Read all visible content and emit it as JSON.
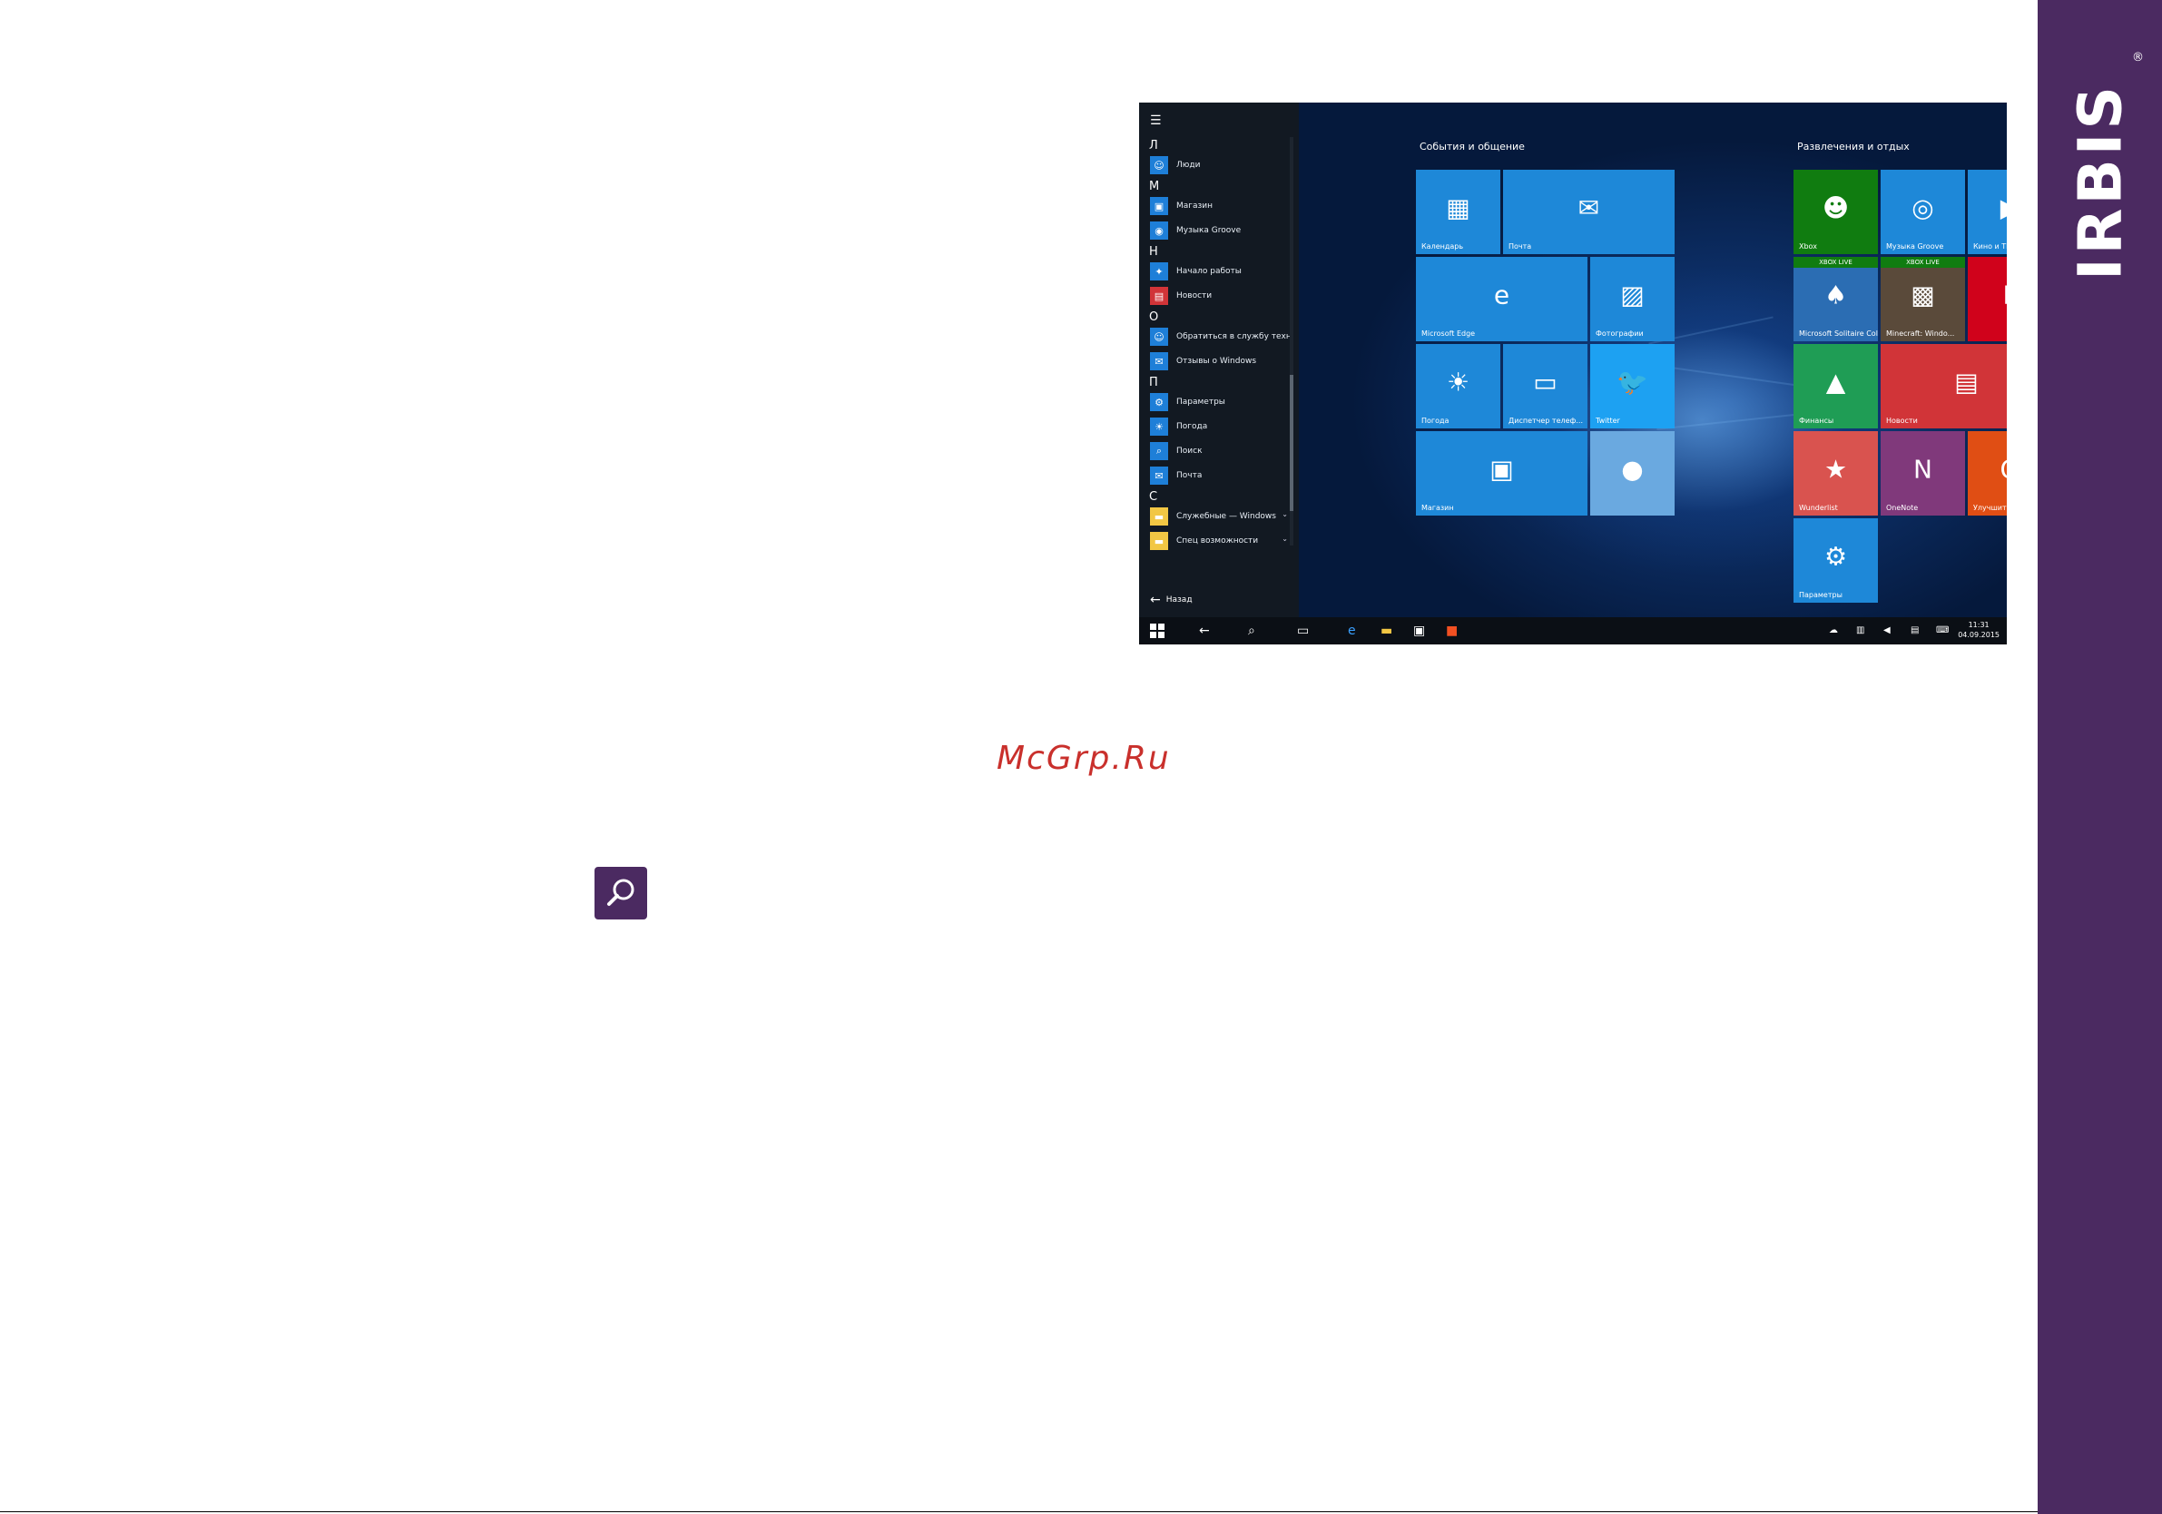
{
  "brand": {
    "name": "IRBIS",
    "reg": "®"
  },
  "watermark": "McGrp.Ru",
  "start_list": {
    "items": [
      {
        "type": "letter",
        "text": "Л"
      },
      {
        "type": "app",
        "label": "Люди",
        "color": "#1e7fd8",
        "icon": "people-icon"
      },
      {
        "type": "letter",
        "text": "М"
      },
      {
        "type": "app",
        "label": "Магазин",
        "color": "#1e7fd8",
        "icon": "store-icon"
      },
      {
        "type": "app",
        "label": "Музыка Groove",
        "color": "#1e7fd8",
        "icon": "music-icon"
      },
      {
        "type": "letter",
        "text": "Н"
      },
      {
        "type": "app",
        "label": "Начало работы",
        "color": "#1e7fd8",
        "icon": "bulb-icon"
      },
      {
        "type": "app",
        "label": "Новости",
        "color": "#d13438",
        "icon": "news-icon"
      },
      {
        "type": "letter",
        "text": "О"
      },
      {
        "type": "app",
        "label": "Обратиться в службу технич...",
        "color": "#1e7fd8",
        "icon": "support-icon"
      },
      {
        "type": "app",
        "label": "Отзывы о Windows",
        "color": "#1e7fd8",
        "icon": "feedback-icon"
      },
      {
        "type": "letter",
        "text": "П"
      },
      {
        "type": "app",
        "label": "Параметры",
        "color": "#1e7fd8",
        "icon": "gear-icon"
      },
      {
        "type": "app",
        "label": "Погода",
        "color": "#1e7fd8",
        "icon": "weather-icon"
      },
      {
        "type": "app",
        "label": "Поиск",
        "color": "#1e7fd8",
        "icon": "search-icon"
      },
      {
        "type": "app",
        "label": "Почта",
        "color": "#1e7fd8",
        "icon": "mail-icon"
      },
      {
        "type": "letter",
        "text": "С"
      },
      {
        "type": "app",
        "label": "Служебные — Windows",
        "color": "#f2c744",
        "icon": "folder-icon",
        "expand": true
      },
      {
        "type": "app",
        "label": "Спец возможности",
        "color": "#f2c744",
        "icon": "folder-icon",
        "expand": true
      }
    ],
    "back_label": "Назад"
  },
  "groups": [
    {
      "title": "События и общение"
    },
    {
      "title": "Развлечения и отдых"
    }
  ],
  "tiles": [
    {
      "label": "Календарь",
      "color": "#1e88d8",
      "icon": "calendar-icon"
    },
    {
      "label": "Почта",
      "color": "#1e88d8",
      "icon": "mail-icon"
    },
    {
      "label": "Microsoft Edge",
      "color": "#1e88d8",
      "icon": "edge-icon"
    },
    {
      "label": "Фотографии",
      "color": "#1e88d8",
      "icon": "photos-icon"
    },
    {
      "label": "Погода",
      "color": "#1e88d8",
      "icon": "weather-icon"
    },
    {
      "label": "Диспетчер телеф...",
      "color": "#1e88d8",
      "icon": "phone-icon"
    },
    {
      "label": "Twitter",
      "color": "#1da1f2",
      "icon": "twitter-icon"
    },
    {
      "label": "Магазин",
      "color": "#1e88d8",
      "icon": "store-icon"
    },
    {
      "label": "",
      "color": "#6aa9e0",
      "icon": "candy-icon"
    },
    {
      "label": "Xbox",
      "color": "#107c10",
      "icon": "xbox-icon"
    },
    {
      "label": "Музыка Groove",
      "color": "#1e88d8",
      "icon": "music-icon"
    },
    {
      "label": "Кино и ТВ",
      "color": "#1e88d8",
      "icon": "film-icon"
    },
    {
      "label": "Microsoft Solitaire Collection",
      "color": "#2b6db3",
      "icon": "cards-icon",
      "badge": "XBOX LIVE"
    },
    {
      "label": "Minecraft: Windo...",
      "color": "#5a4a3a",
      "icon": "minecraft-icon",
      "badge": "XBOX LIVE"
    },
    {
      "label": "",
      "color": "#d0021b",
      "icon": "flipboard-icon"
    },
    {
      "label": "Финансы",
      "color": "#1f9d55",
      "icon": "finance-icon"
    },
    {
      "label": "Новости",
      "color": "#d13438",
      "icon": "news-icon"
    },
    {
      "label": "Wunderlist",
      "color": "#d9534f",
      "icon": "star-icon"
    },
    {
      "label": "OneNote",
      "color": "#80397b",
      "icon": "onenote-icon"
    },
    {
      "label": "Улучшите...",
      "color": "#e04e14",
      "icon": "office-icon"
    },
    {
      "label": "Параметры",
      "color": "#1e88d8",
      "icon": "gear-icon"
    }
  ],
  "taskbar": {
    "time": "11:31",
    "date": "04.09.2015"
  }
}
